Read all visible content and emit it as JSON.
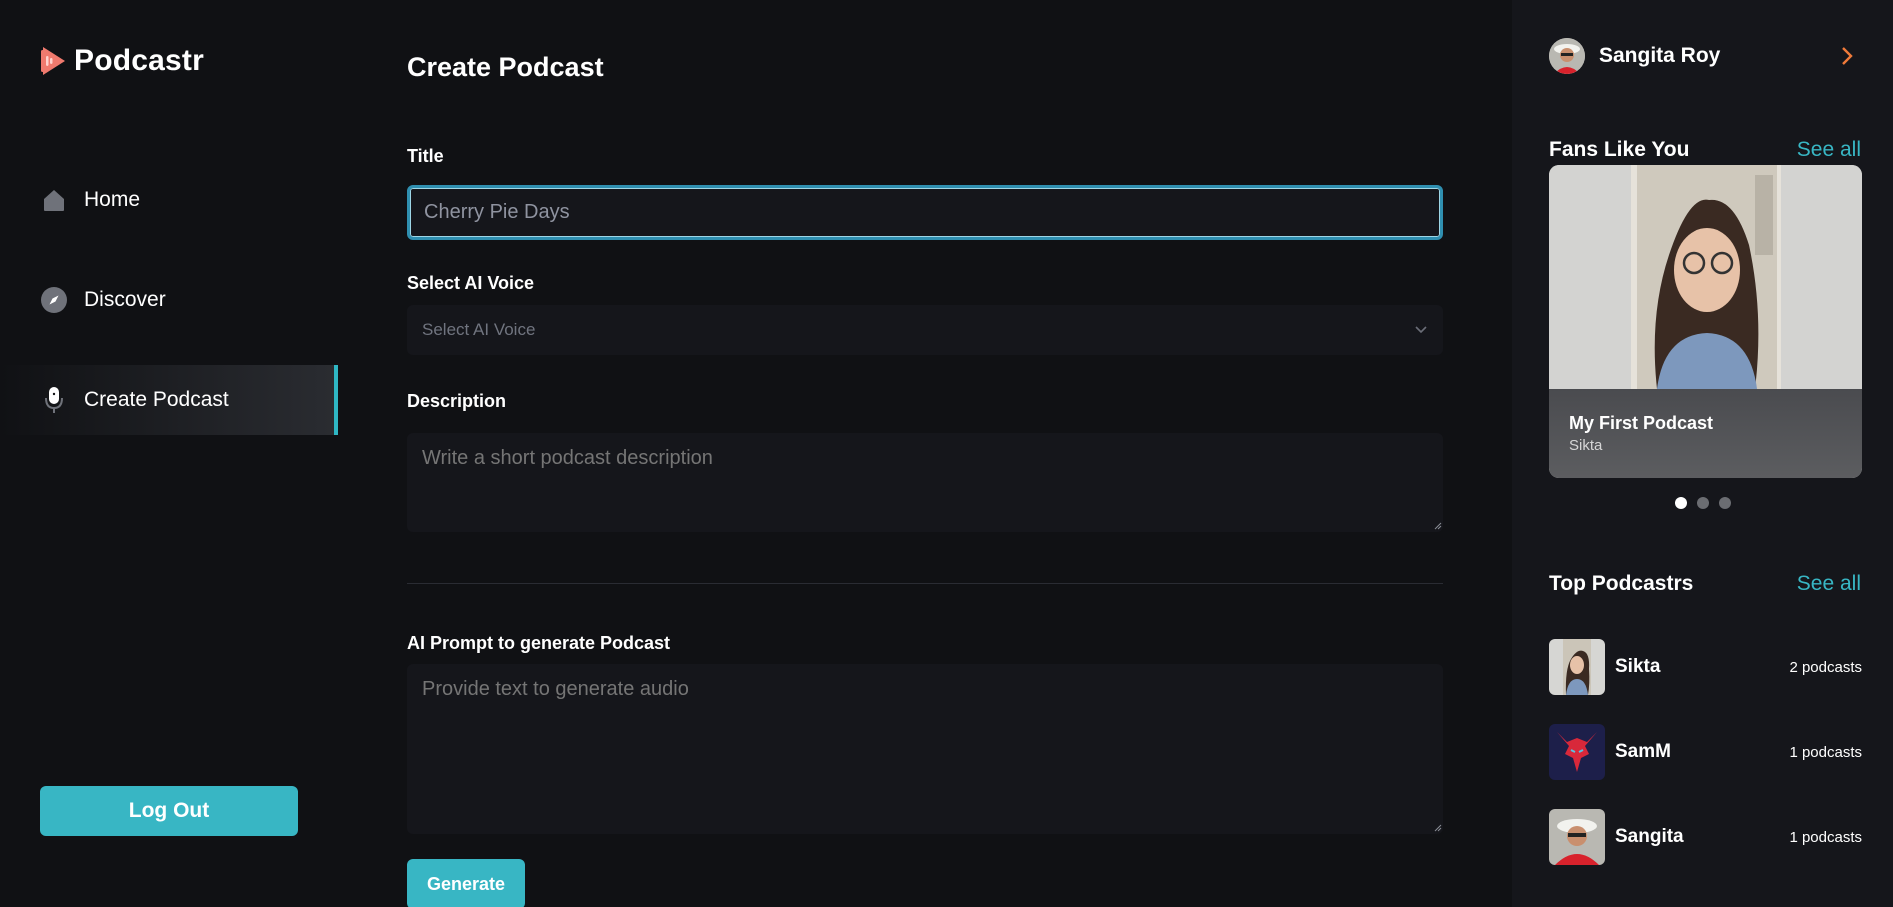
{
  "app": {
    "name": "Podcastr"
  },
  "nav": [
    {
      "label": "Home",
      "icon": "home-icon"
    },
    {
      "label": "Discover",
      "icon": "compass-icon"
    },
    {
      "label": "Create Podcast",
      "icon": "microphone-icon",
      "active": true
    }
  ],
  "logout_label": "Log Out",
  "form": {
    "page_title": "Create Podcast",
    "title_label": "Title",
    "title_value": "Cherry Pie Days",
    "voice_label": "Select AI Voice",
    "voice_placeholder": "Select AI Voice",
    "description_label": "Description",
    "description_placeholder": "Write a short podcast description",
    "prompt_label": "AI Prompt to generate Podcast",
    "prompt_placeholder": "Provide text to generate audio",
    "generate_label": "Generate"
  },
  "user": {
    "name": "Sangita Roy"
  },
  "fans": {
    "title": "Fans Like You",
    "see_all": "See all",
    "card_title": "My First Podcast",
    "card_author": "Sikta",
    "active_dot": 0
  },
  "top": {
    "title": "Top Podcastrs",
    "see_all": "See all",
    "items": [
      {
        "name": "Sikta",
        "count": "2 podcasts"
      },
      {
        "name": "SamM",
        "count": "1 podcasts"
      },
      {
        "name": "Sangita",
        "count": "1 podcasts"
      }
    ]
  },
  "colors": {
    "accent": "#38b6c4",
    "background": "#101114",
    "panel": "#15161b",
    "logo": "#f07a6e"
  }
}
